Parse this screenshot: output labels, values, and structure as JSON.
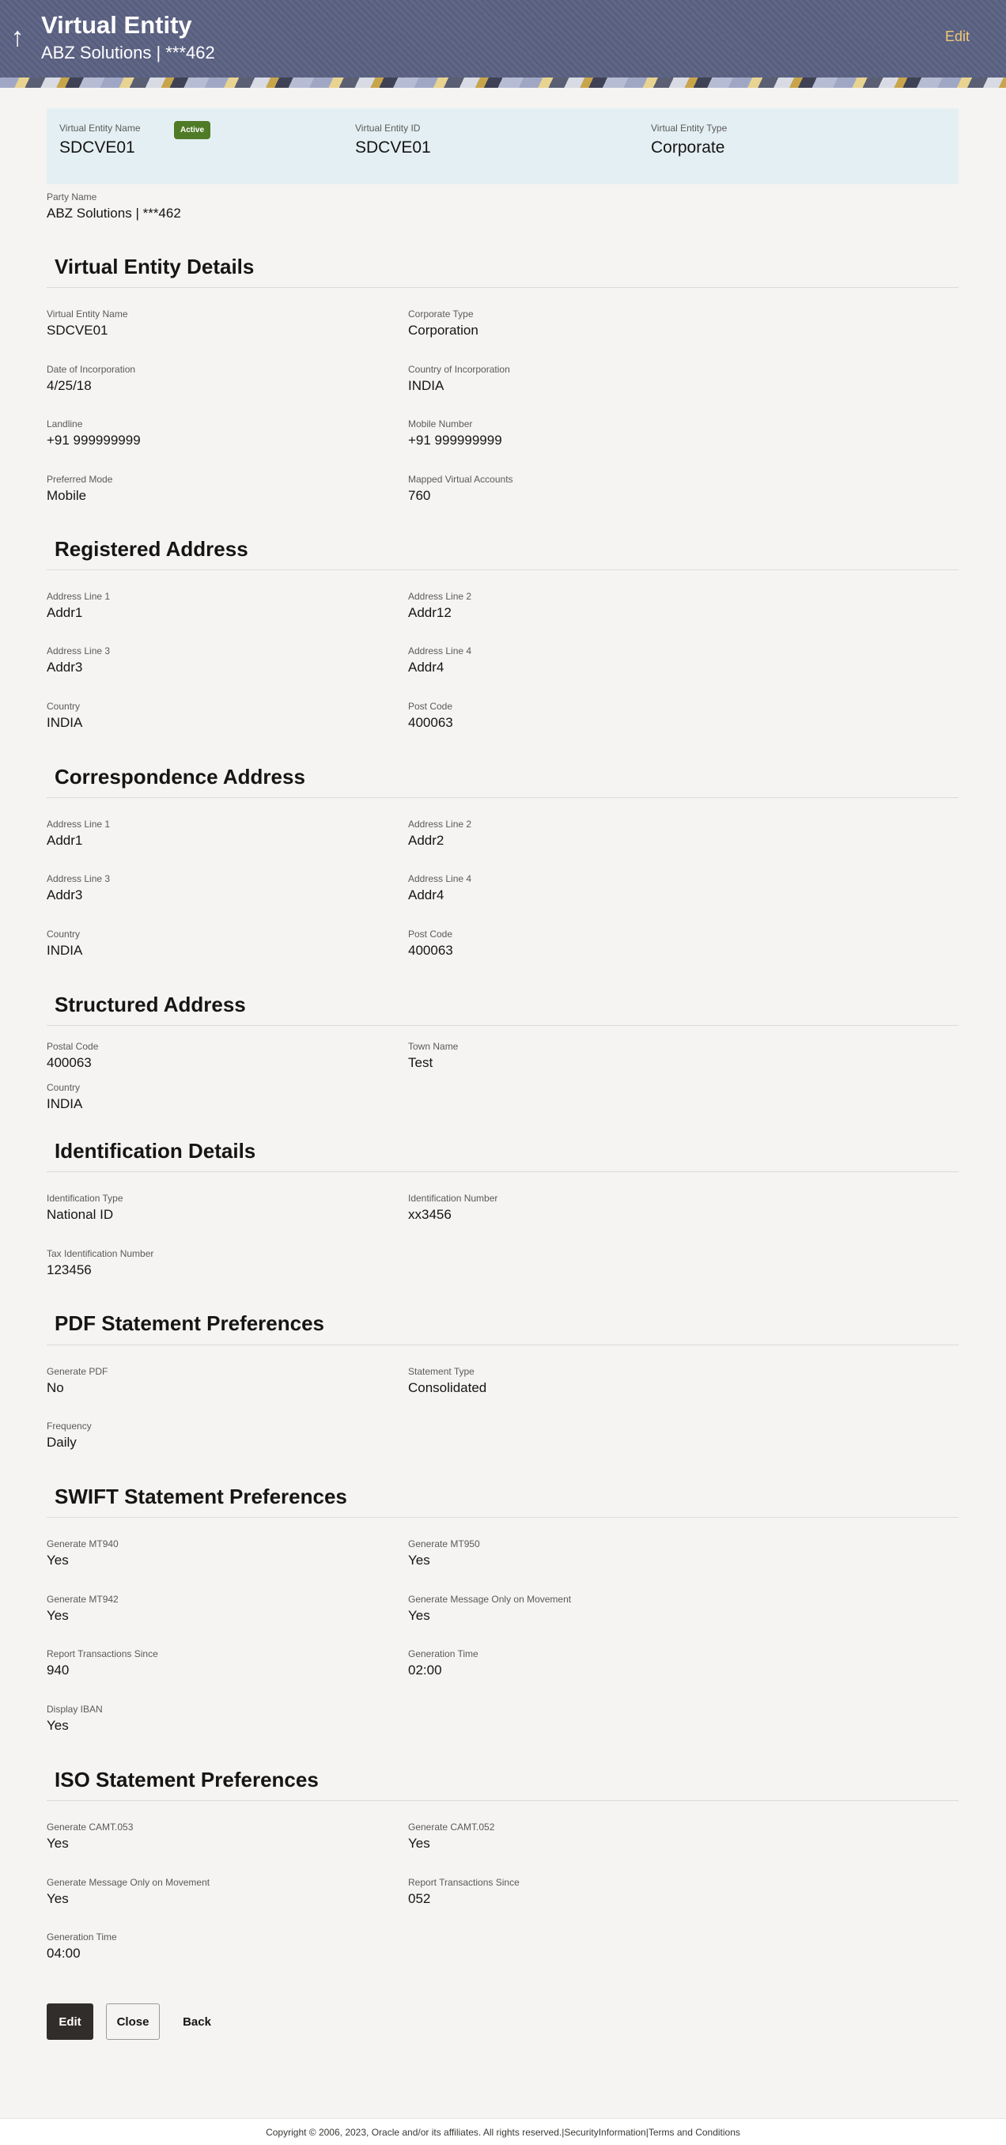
{
  "header": {
    "back_icon": "up-arrow-icon",
    "title": "Virtual Entity",
    "subtitle": "ABZ Solutions | ***462",
    "edit_label": "Edit"
  },
  "summary": {
    "name_label": "Virtual Entity Name",
    "name_value": "SDCVE01",
    "status": "Active",
    "id_label": "Virtual Entity ID",
    "id_value": "SDCVE01",
    "type_label": "Virtual Entity Type",
    "type_value": "Corporate"
  },
  "party": {
    "label": "Party Name",
    "value": "ABZ Solutions | ***462"
  },
  "details": {
    "title": "Virtual Entity Details",
    "fields": [
      {
        "label": "Virtual Entity Name",
        "value": "SDCVE01"
      },
      {
        "label": "Corporate Type",
        "value": "Corporation"
      },
      {
        "label": "Date of Incorporation",
        "value": "4/25/18"
      },
      {
        "label": "Country of Incorporation",
        "value": "INDIA"
      },
      {
        "label": "Landline",
        "value": "+91 999999999"
      },
      {
        "label": "Mobile Number",
        "value": "+91 999999999"
      },
      {
        "label": "Preferred Mode",
        "value": "Mobile"
      },
      {
        "label": "Mapped Virtual Accounts",
        "value": "760"
      }
    ]
  },
  "registered": {
    "title": "Registered Address",
    "fields": [
      {
        "label": "Address Line 1",
        "value": "Addr1"
      },
      {
        "label": "Address Line 2",
        "value": "Addr12"
      },
      {
        "label": "Address Line 3",
        "value": "Addr3"
      },
      {
        "label": "Address Line 4",
        "value": "Addr4"
      },
      {
        "label": "Country",
        "value": "INDIA"
      },
      {
        "label": "Post Code",
        "value": "400063"
      }
    ]
  },
  "correspondence": {
    "title": "Correspondence Address",
    "fields": [
      {
        "label": "Address Line 1",
        "value": "Addr1"
      },
      {
        "label": "Address Line 2",
        "value": "Addr2"
      },
      {
        "label": "Address Line 3",
        "value": "Addr3"
      },
      {
        "label": "Address Line 4",
        "value": "Addr4"
      },
      {
        "label": "Country",
        "value": "INDIA"
      },
      {
        "label": "Post Code",
        "value": "400063"
      }
    ]
  },
  "structured": {
    "title": "Structured Address",
    "fields": [
      {
        "label": "Postal Code",
        "value": "400063"
      },
      {
        "label": "Town Name",
        "value": "Test"
      },
      {
        "label": "Country",
        "value": "INDIA"
      }
    ]
  },
  "identification": {
    "title": "Identification Details",
    "fields": [
      {
        "label": "Identification Type",
        "value": "National ID"
      },
      {
        "label": "Identification Number",
        "value": "xx3456"
      },
      {
        "label": "Tax Identification Number",
        "value": "123456"
      }
    ]
  },
  "pdf": {
    "title": "PDF Statement Preferences",
    "fields": [
      {
        "label": "Generate PDF",
        "value": "No"
      },
      {
        "label": "Statement Type",
        "value": "Consolidated"
      },
      {
        "label": "Frequency",
        "value": "Daily"
      }
    ]
  },
  "swift": {
    "title": "SWIFT Statement Preferences",
    "fields": [
      {
        "label": "Generate MT940",
        "value": "Yes"
      },
      {
        "label": "Generate MT950",
        "value": "Yes"
      },
      {
        "label": "Generate MT942",
        "value": "Yes"
      },
      {
        "label": "Generate Message Only on Movement",
        "value": "Yes"
      },
      {
        "label": "Report Transactions Since",
        "value": "940"
      },
      {
        "label": "Generation Time",
        "value": "02:00"
      },
      {
        "label": "Display IBAN",
        "value": "Yes"
      }
    ]
  },
  "iso": {
    "title": "ISO Statement Preferences",
    "fields": [
      {
        "label": "Generate CAMT.053",
        "value": "Yes"
      },
      {
        "label": "Generate CAMT.052",
        "value": "Yes"
      },
      {
        "label": "Generate Message Only on Movement",
        "value": "Yes"
      },
      {
        "label": "Report Transactions Since",
        "value": "052"
      },
      {
        "label": "Generation Time",
        "value": "04:00"
      }
    ]
  },
  "actions": {
    "edit": "Edit",
    "close": "Close",
    "back": "Back"
  },
  "footer": {
    "text": "Copyright © 2006, 2023, Oracle and/or its affiliates. All rights reserved.|SecurityInformation|Terms and Conditions"
  },
  "colors": {
    "header_bg": "#5b6182",
    "edit_link": "#f0c87a",
    "badge_active": "#4f7b27",
    "summary_bg": "#e4eff3",
    "primary_button": "#312d2a"
  }
}
